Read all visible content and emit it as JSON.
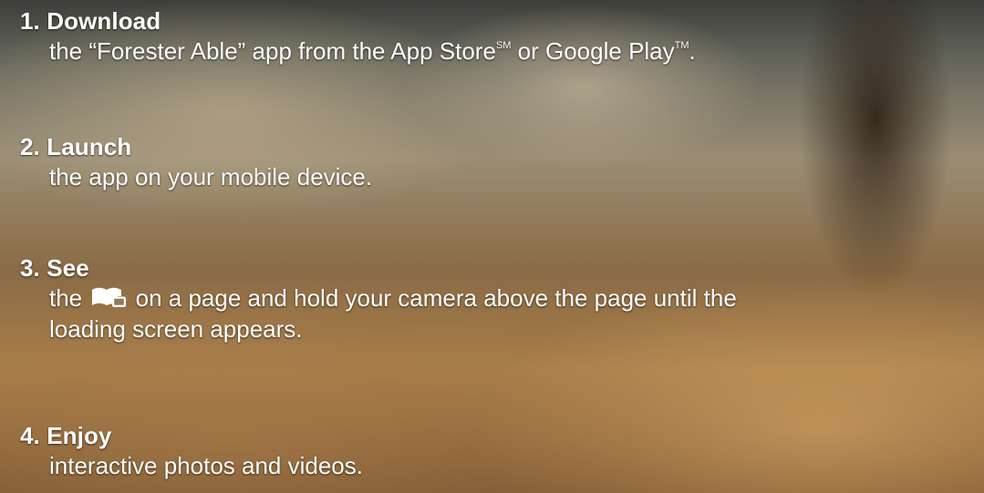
{
  "steps": [
    {
      "title": "1. Download",
      "body_part1": "the “Forester Able” app from the App Store",
      "store1_mark": "SM",
      "body_part2": " or Google Play",
      "store2_mark": "TM",
      "body_part3": "."
    },
    {
      "title": "2. Launch",
      "body": "the app on your mobile device."
    },
    {
      "title": "3. See",
      "body_before_icon": "the",
      "icon": "book-and-phone-icon",
      "body_after_icon": "on a page and hold your camera above the page until the",
      "body_line2": "loading screen appears."
    },
    {
      "title": "4. Enjoy",
      "body": "interactive photos and videos."
    }
  ]
}
